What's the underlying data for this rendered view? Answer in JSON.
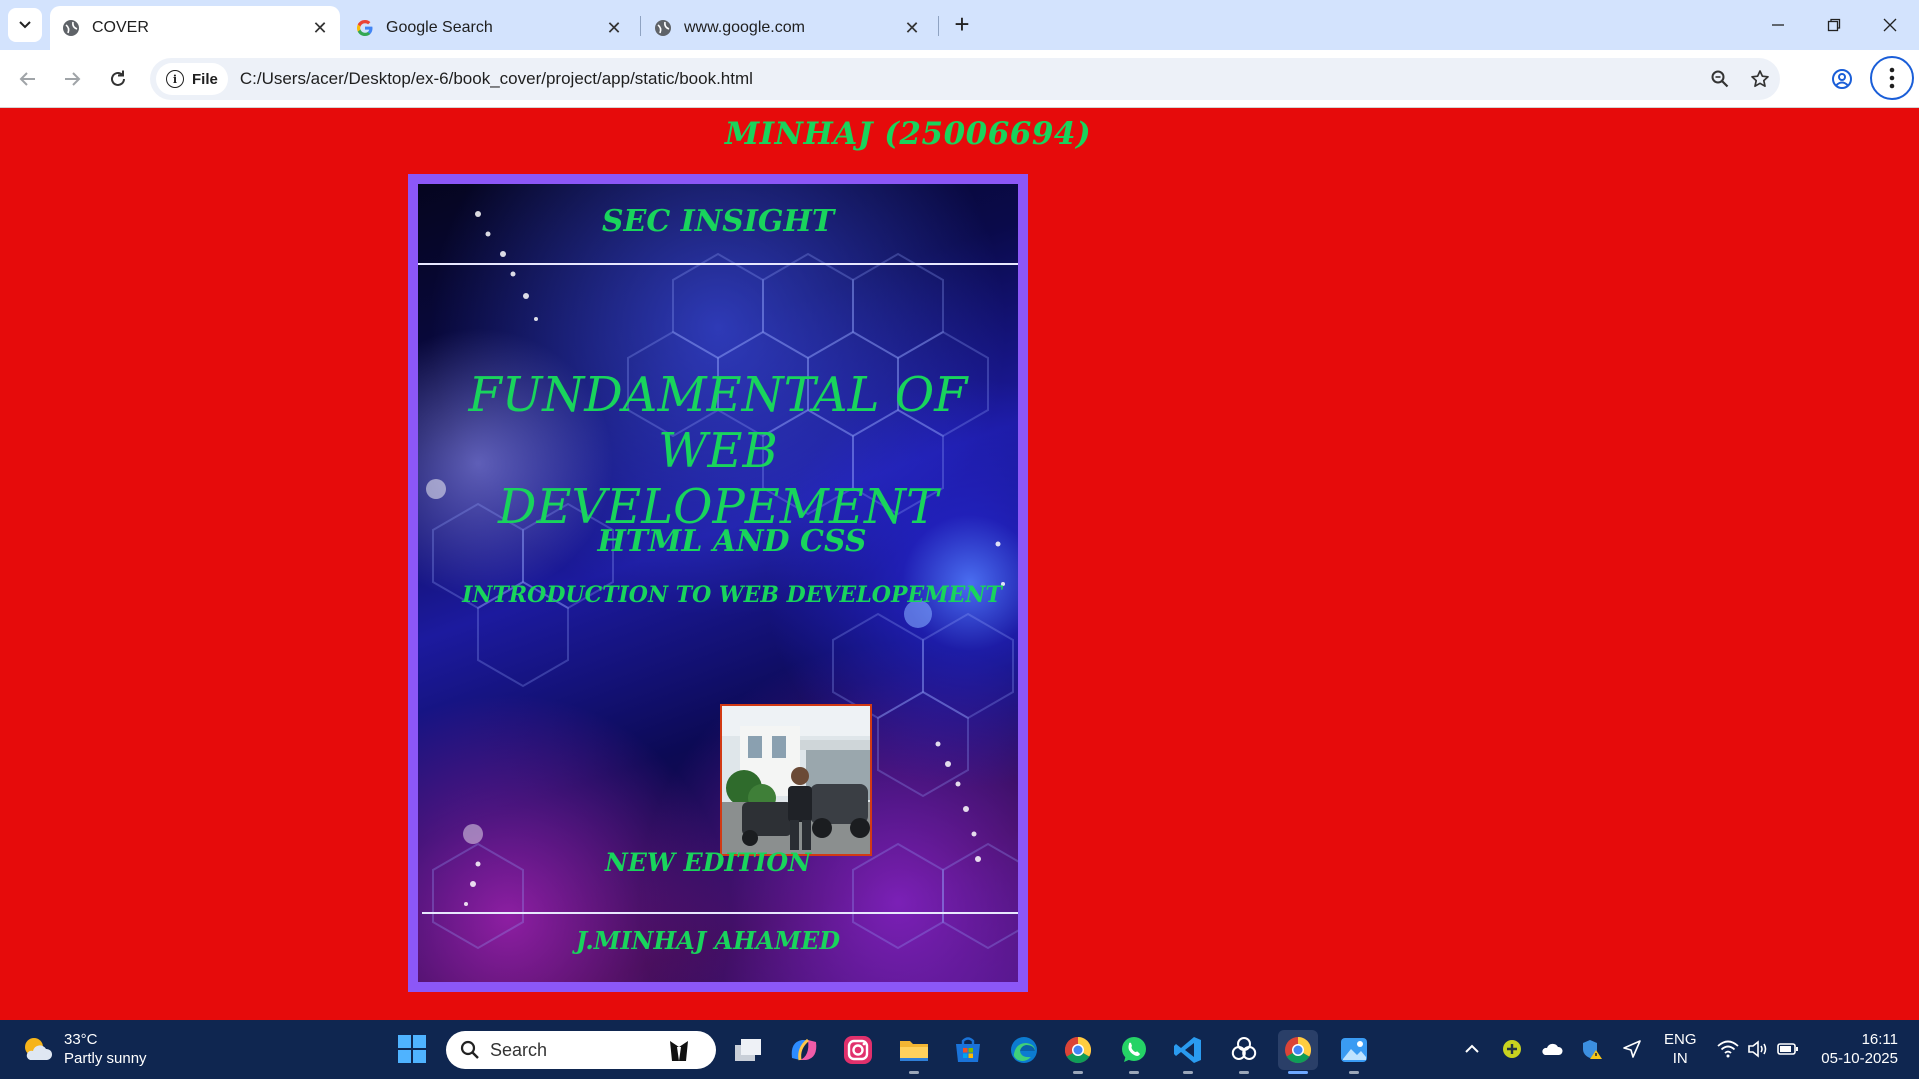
{
  "browser": {
    "tabs": [
      {
        "title": "COVER",
        "active": true,
        "favicon": "globe-icon"
      },
      {
        "title": "Google Search",
        "active": false,
        "favicon": "google-g-icon"
      },
      {
        "title": "www.google.com",
        "active": false,
        "favicon": "globe-icon"
      }
    ],
    "address_chip": "File",
    "url": "C:/Users/acer/Desktop/ex-6/book_cover/project/app/static/book.html"
  },
  "page": {
    "heading": "MINHAJ (25006694)",
    "background_color": "#e60b0b",
    "text_color": "#19d45c"
  },
  "book": {
    "series": "SEC INSIGHT",
    "title_line1": "FUNDAMENTAL OF WEB",
    "title_line2": "DEVELOPEMENT",
    "subtitle": "HTML AND CSS",
    "tagline": "INTRODUCTION TO WEB DEVELOPEMENT",
    "edition": "NEW EDITION",
    "author": "J.MINHAJ AHAMED",
    "frame_color": "#8c57f7"
  },
  "taskbar": {
    "weather_temp": "33°C",
    "weather_desc": "Partly sunny",
    "search_placeholder": "Search",
    "lang_line1": "ENG",
    "lang_line2": "IN",
    "time": "16:11",
    "date": "05-10-2025",
    "apps": [
      "task-view-icon",
      "copilot-icon",
      "instagram-icon",
      "file-explorer-icon",
      "microsoft-store-icon",
      "edge-icon",
      "chrome-icon",
      "whatsapp-icon",
      "vscode-icon",
      "chatgpt-icon",
      "chrome-icon",
      "photos-icon"
    ]
  }
}
